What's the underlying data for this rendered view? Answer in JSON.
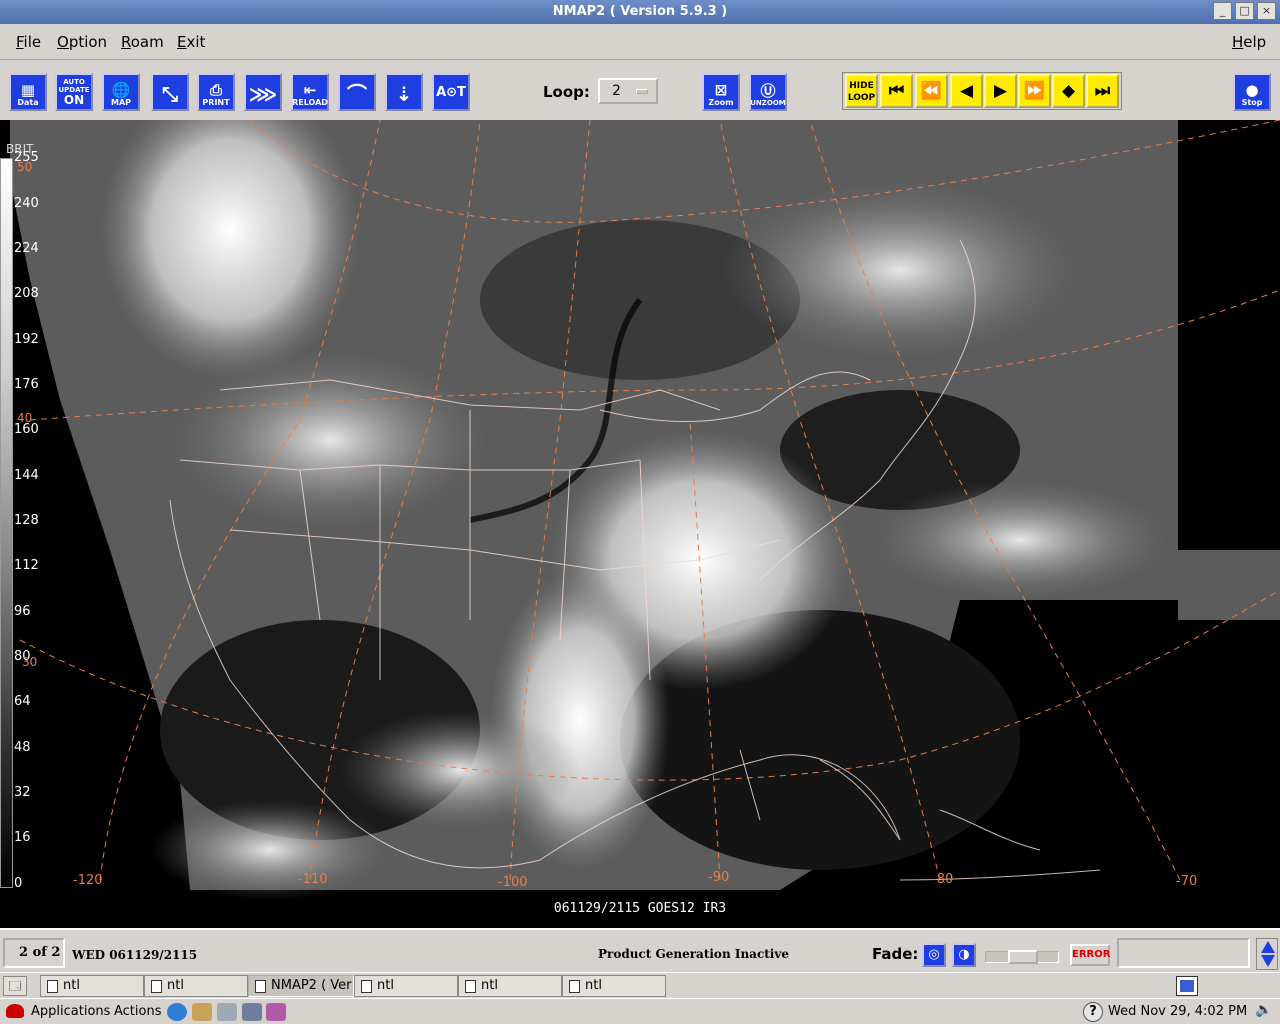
{
  "window": {
    "title": "NMAP2 ( Version 5.9.3 )",
    "minimize": "_",
    "maximize": "□",
    "close": "×"
  },
  "menu": {
    "file_u": "F",
    "file_rest": "ile",
    "option_u": "O",
    "option_rest": "ption",
    "roam_u": "R",
    "roam_rest": "oam",
    "exit_u": "E",
    "exit_rest": "xit",
    "help_u": "H",
    "help_rest": "elp"
  },
  "toolbar": {
    "data_label": "Data",
    "auto_line1": "AUTO",
    "auto_line2": "UPDATE",
    "auto_line3": "ON",
    "map_label": "MAP",
    "print_label": "PRINT",
    "reload_label": "RELOAD",
    "loop_label": "Loop:",
    "loop_value": "2",
    "zoom_label": "Zoom",
    "unzoom_label": "UNZOOM",
    "hide_loop_label": "HIDE LOOP",
    "stop_label": "Stop"
  },
  "map": {
    "product_label": "061129/2115 GOES12   IR3",
    "scale_title": "BRIT",
    "scale_ticks": [
      "255",
      "240",
      "224",
      "208",
      "192",
      "176",
      "160",
      "144",
      "128",
      "112",
      "96",
      "80",
      "64",
      "48",
      "32",
      "16",
      "0"
    ],
    "lon_labels": [
      "-120",
      "-110",
      "-100",
      "-90",
      "-80",
      "-70"
    ],
    "lat_labels": [
      "50",
      "40",
      "30"
    ]
  },
  "status": {
    "frame_count": "2 of 2",
    "frame_time": "WED 061129/2115",
    "product_generation": "Product Generation Inactive",
    "fade_label": "Fade:",
    "error_label": "ERROR"
  },
  "taskbar": {
    "tasks": [
      "ntl",
      "ntl",
      "NMAP2 ( Ver",
      "ntl",
      "ntl",
      "ntl"
    ]
  },
  "panel": {
    "applications": "Applications",
    "actions": "Actions",
    "clock": "Wed Nov 29,  4:02 PM",
    "help_glyph": "?"
  },
  "colors": {
    "toolbar_blue": "#1f3ee0",
    "loop_yellow": "#ffeb00",
    "grid_orange": "#e87d48"
  }
}
